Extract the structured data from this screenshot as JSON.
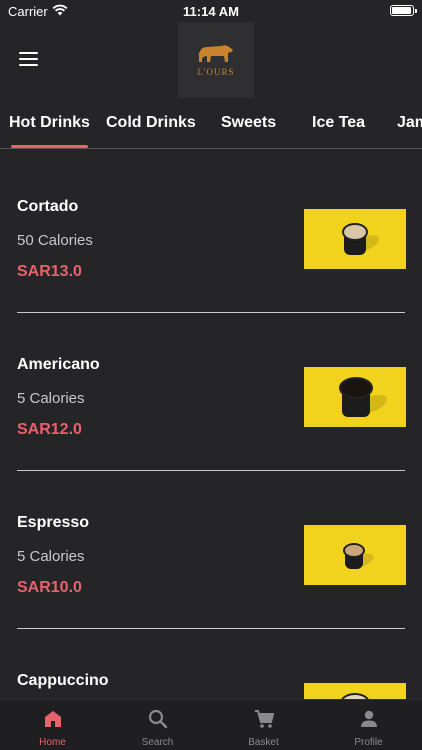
{
  "status_bar": {
    "carrier": "Carrier",
    "time": "11:14 AM"
  },
  "header": {
    "logo_text": "L'OURS"
  },
  "tabs": [
    {
      "label": "Hot Drinks",
      "active": true
    },
    {
      "label": "Cold Drinks",
      "active": false
    },
    {
      "label": "Sweets",
      "active": false
    },
    {
      "label": "Ice Tea",
      "active": false
    },
    {
      "label": "Jam",
      "active": false
    }
  ],
  "menu_items": [
    {
      "name": "Cortado",
      "calories": "50 Calories",
      "price": "SAR13.0"
    },
    {
      "name": "Americano",
      "calories": "5 Calories",
      "price": "SAR12.0"
    },
    {
      "name": "Espresso",
      "calories": "5 Calories",
      "price": "SAR10.0"
    },
    {
      "name": "Cappuccino",
      "calories": "",
      "price": ""
    }
  ],
  "bottom_nav": [
    {
      "label": "Home",
      "icon": "home-icon",
      "active": true
    },
    {
      "label": "Search",
      "icon": "search-icon",
      "active": false
    },
    {
      "label": "Basket",
      "icon": "basket-icon",
      "active": false
    },
    {
      "label": "Profile",
      "icon": "profile-icon",
      "active": false
    }
  ],
  "colors": {
    "accent": "#e8626b",
    "background": "#252528",
    "image_background": "#f1d21c"
  }
}
